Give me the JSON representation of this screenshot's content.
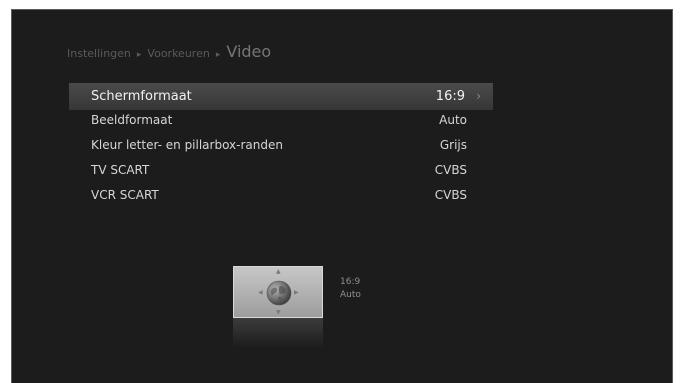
{
  "breadcrumb": {
    "items": [
      "Instellingen",
      "Voorkeuren"
    ],
    "separator": "▸",
    "current": "Video"
  },
  "menu": {
    "rows": [
      {
        "label": "Schermformaat",
        "value": "16:9",
        "selected": true
      },
      {
        "label": "Beeldformaat",
        "value": "Auto",
        "selected": false
      },
      {
        "label": "Kleur letter- en pillarbox-randen",
        "value": "Grijs",
        "selected": false
      },
      {
        "label": "TV SCART",
        "value": "CVBS",
        "selected": false
      },
      {
        "label": "VCR SCART",
        "value": "CVBS",
        "selected": false
      }
    ],
    "chevron": "›"
  },
  "preview": {
    "aspect": "16:9",
    "format": "Auto",
    "icon": "globe-icon"
  },
  "colors": {
    "screen_bg": "#1c1c1c",
    "selected_row": "#424242",
    "text": "#d6d6d6"
  }
}
